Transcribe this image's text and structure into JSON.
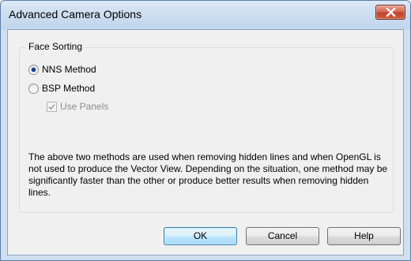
{
  "window": {
    "title": "Advanced Camera Options"
  },
  "group": {
    "title": "Face Sorting",
    "options": [
      {
        "label": "NNS Method",
        "checked": true
      },
      {
        "label": "BSP Method",
        "checked": false
      }
    ],
    "use_panels": {
      "label": "Use Panels",
      "checked": true,
      "enabled": false
    }
  },
  "description": "The above two methods are used when removing hidden lines and when OpenGL is not used to produce the Vector View. Depending on the situation, one method may be significantly faster than the other or produce better results when removing hidden lines.",
  "buttons": {
    "ok": "OK",
    "cancel": "Cancel",
    "help": "Help"
  },
  "icons": {
    "close": "close-icon",
    "check": "checkmark-icon"
  },
  "colors": {
    "title_bar": "#c9dbef",
    "close_button": "#c1412a",
    "default_button_border": "#3c7fb1",
    "dialog_bg": "#f0f0f0"
  }
}
